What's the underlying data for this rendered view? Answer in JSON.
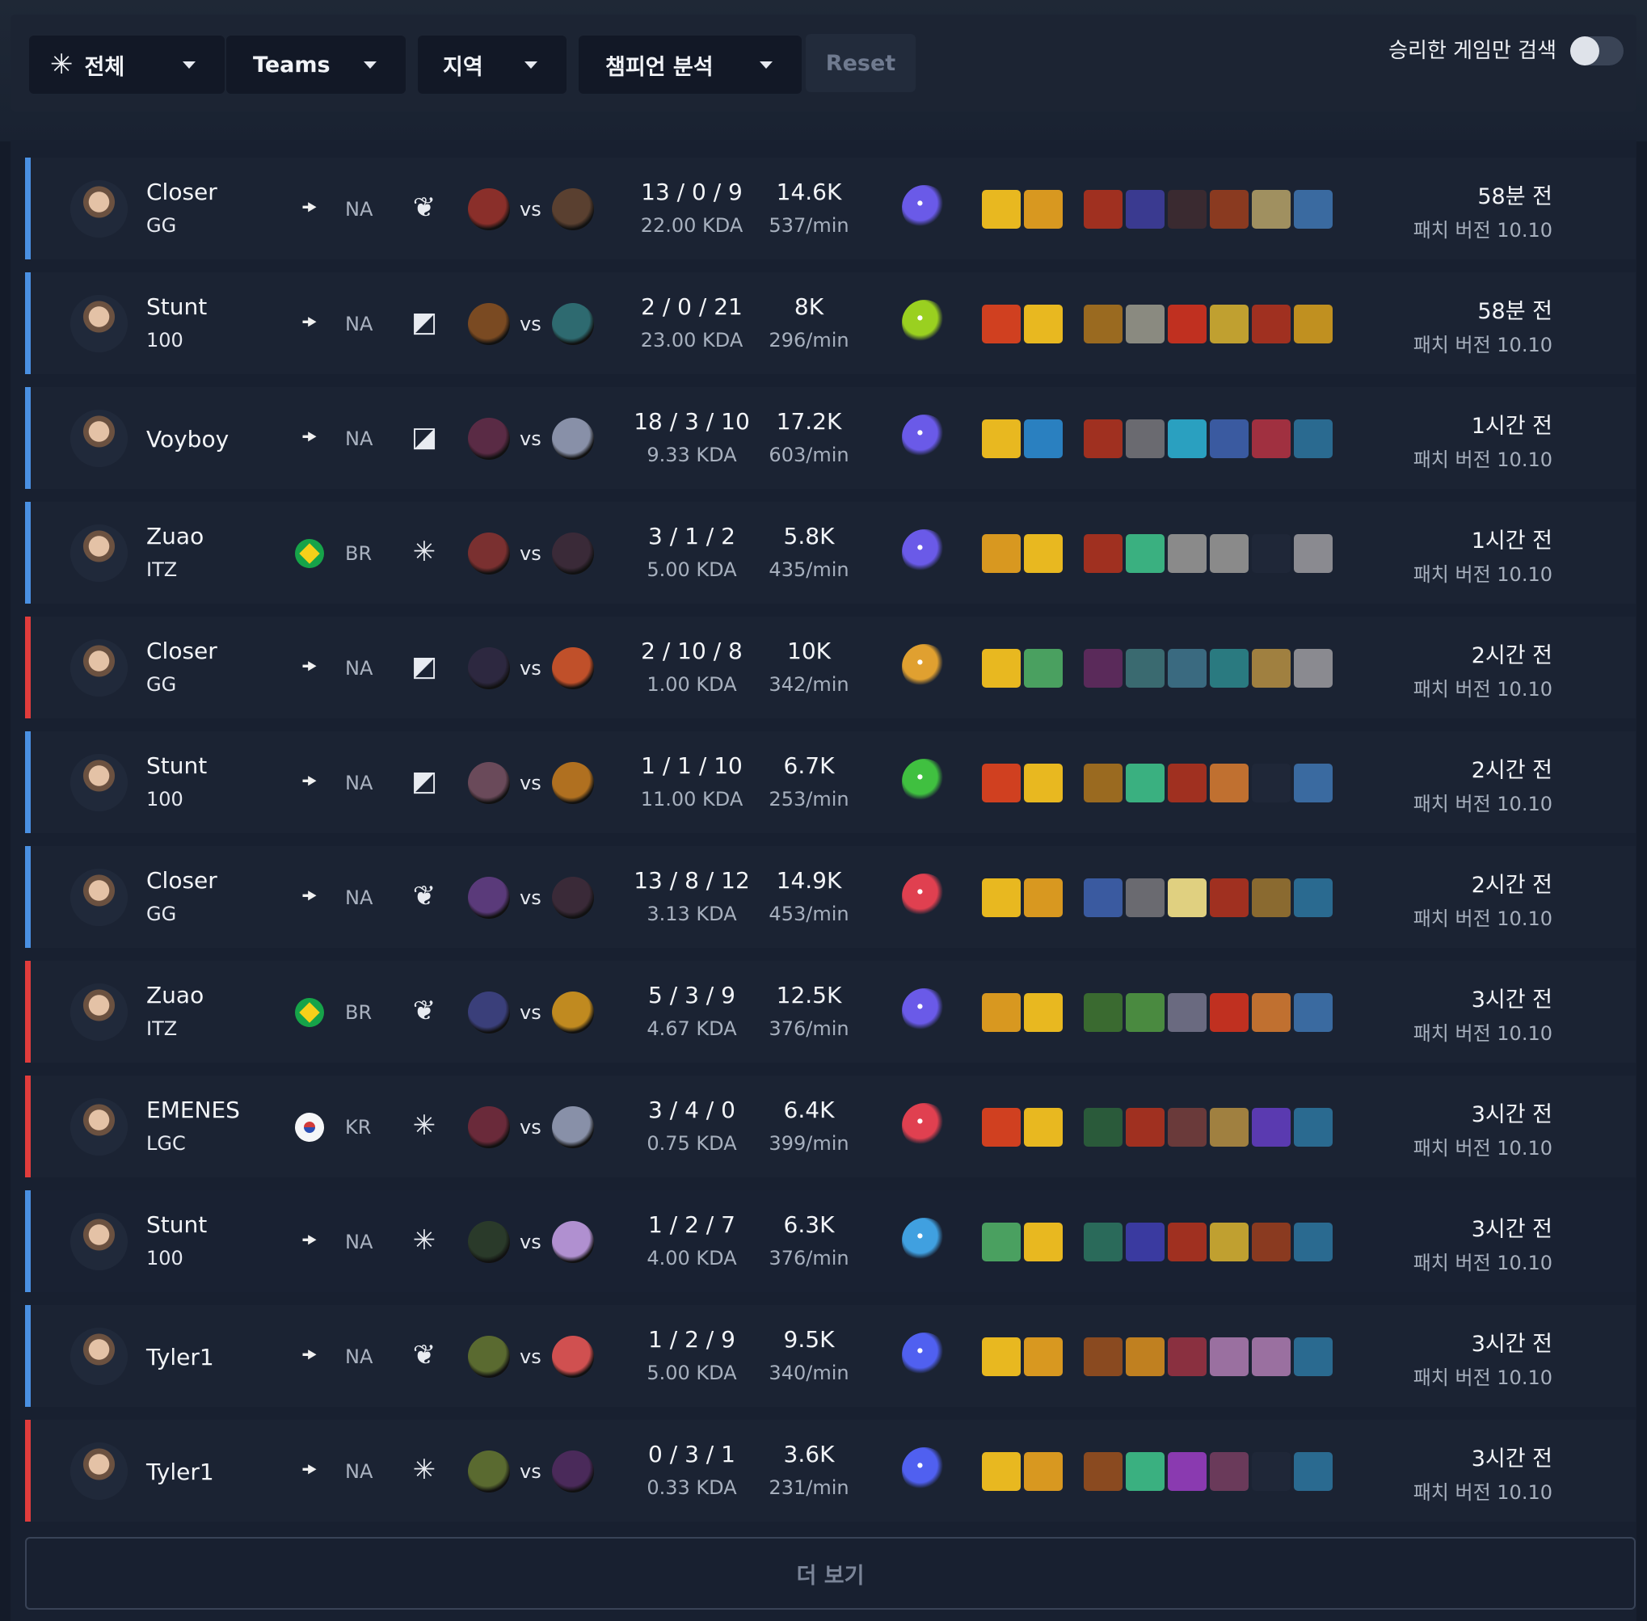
{
  "filters": {
    "all_label": "전체",
    "teams_label": "Teams",
    "region_label": "지역",
    "champion_label": "챔피언 분석",
    "reset_label": "Reset",
    "wins_only_label": "승리한 게임만 검색",
    "wins_only_enabled": false
  },
  "vs_label": "vs",
  "more_label": "더 보기",
  "colors": {
    "win": "#4a90e2",
    "loss": "#e03c3c",
    "accent_yellow": "#f5c518"
  },
  "matches": [
    {
      "result": "win",
      "player": "Closer",
      "team": "GG",
      "flag": "na",
      "region": "NA",
      "role": "jungle-icon",
      "kda": "13 / 0 / 9",
      "kda_ratio": "22.00 KDA",
      "gold": "14.6K",
      "gold_rate": "537/min",
      "time": "58분 전",
      "patch": "패치 버전 10.10"
    },
    {
      "result": "win",
      "player": "Stunt",
      "team": "100",
      "flag": "na",
      "region": "NA",
      "role": "support-icon",
      "kda": "2 / 0 / 21",
      "kda_ratio": "23.00 KDA",
      "gold": "8K",
      "gold_rate": "296/min",
      "time": "58분 전",
      "patch": "패치 버전 10.10"
    },
    {
      "result": "win",
      "player": "Voyboy",
      "team": "",
      "flag": "na",
      "region": "NA",
      "role": "mid-icon",
      "kda": "18 / 3 / 10",
      "kda_ratio": "9.33 KDA",
      "gold": "17.2K",
      "gold_rate": "603/min",
      "time": "1시간 전",
      "patch": "패치 버전 10.10"
    },
    {
      "result": "win",
      "player": "Zuao",
      "team": "ITZ",
      "flag": "br",
      "region": "BR",
      "role": "all-roles-icon",
      "kda": "3 / 1 / 2",
      "kda_ratio": "5.00 KDA",
      "gold": "5.8K",
      "gold_rate": "435/min",
      "time": "1시간 전",
      "patch": "패치 버전 10.10"
    },
    {
      "result": "loss",
      "player": "Closer",
      "team": "GG",
      "flag": "na",
      "region": "NA",
      "role": "support-icon",
      "kda": "2 / 10 / 8",
      "kda_ratio": "1.00 KDA",
      "gold": "10K",
      "gold_rate": "342/min",
      "time": "2시간 전",
      "patch": "패치 버전 10.10"
    },
    {
      "result": "win",
      "player": "Stunt",
      "team": "100",
      "flag": "na",
      "region": "NA",
      "role": "support-icon",
      "kda": "1 / 1 / 10",
      "kda_ratio": "11.00 KDA",
      "gold": "6.7K",
      "gold_rate": "253/min",
      "time": "2시간 전",
      "patch": "패치 버전 10.10"
    },
    {
      "result": "win",
      "player": "Closer",
      "team": "GG",
      "flag": "na",
      "region": "NA",
      "role": "jungle-icon",
      "kda": "13 / 8 / 12",
      "kda_ratio": "3.13 KDA",
      "gold": "14.9K",
      "gold_rate": "453/min",
      "time": "2시간 전",
      "patch": "패치 버전 10.10"
    },
    {
      "result": "loss",
      "player": "Zuao",
      "team": "ITZ",
      "flag": "br",
      "region": "BR",
      "role": "jungle-icon",
      "kda": "5 / 3 / 9",
      "kda_ratio": "4.67 KDA",
      "gold": "12.5K",
      "gold_rate": "376/min",
      "time": "3시간 전",
      "patch": "패치 버전 10.10"
    },
    {
      "result": "loss",
      "player": "EMENES",
      "team": "LGC",
      "flag": "kr",
      "region": "KR",
      "role": "all-roles-icon",
      "kda": "3 / 4 / 0",
      "kda_ratio": "0.75 KDA",
      "gold": "6.4K",
      "gold_rate": "399/min",
      "time": "3시간 전",
      "patch": "패치 버전 10.10"
    },
    {
      "result": "win",
      "player": "Stunt",
      "team": "100",
      "flag": "na",
      "region": "NA",
      "role": "all-roles-icon",
      "kda": "1 / 2 / 7",
      "kda_ratio": "4.00 KDA",
      "gold": "6.3K",
      "gold_rate": "376/min",
      "time": "3시간 전",
      "patch": "패치 버전 10.10"
    },
    {
      "result": "win",
      "player": "Tyler1",
      "team": "",
      "flag": "na",
      "region": "NA",
      "role": "jungle-icon",
      "kda": "1 / 2 / 9",
      "kda_ratio": "5.00 KDA",
      "gold": "9.5K",
      "gold_rate": "340/min",
      "time": "3시간 전",
      "patch": "패치 버전 10.10"
    },
    {
      "result": "loss",
      "player": "Tyler1",
      "team": "",
      "flag": "na",
      "region": "NA",
      "role": "all-roles-icon",
      "kda": "0 / 3 / 1",
      "kda_ratio": "0.33 KDA",
      "gold": "3.6K",
      "gold_rate": "231/min",
      "time": "3시간 전",
      "patch": "패치 버전 10.10"
    }
  ]
}
